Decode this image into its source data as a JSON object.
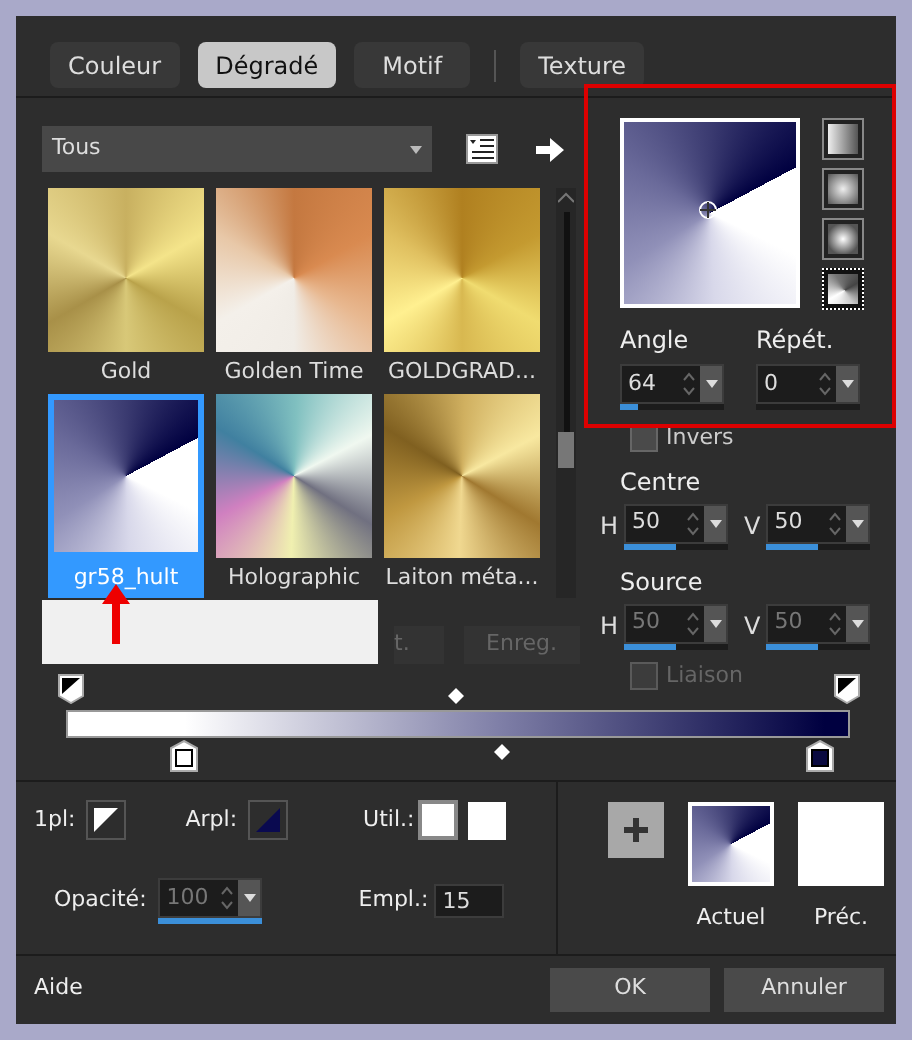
{
  "tabs": [
    {
      "label": "Couleur",
      "selected": false
    },
    {
      "label": "Dégradé",
      "selected": true
    },
    {
      "label": "Motif",
      "selected": false
    },
    {
      "label": "Texture",
      "selected": false
    }
  ],
  "category_dropdown": {
    "value": "Tous"
  },
  "gradients": [
    {
      "name": "Gold",
      "selected": false
    },
    {
      "name": "Golden Time",
      "selected": false
    },
    {
      "name": "GOLDGRAD...",
      "selected": false
    },
    {
      "name": "gr58_hult",
      "selected": true
    },
    {
      "name": "Holographic",
      "selected": false
    },
    {
      "name": "Laiton méta...",
      "selected": false
    }
  ],
  "library_buttons": [
    {
      "label": "t.",
      "disabled": true
    },
    {
      "label": "Enreg.",
      "disabled": true
    }
  ],
  "styles": [
    {
      "kind": "linear",
      "selected": false
    },
    {
      "kind": "rectangular",
      "selected": false
    },
    {
      "kind": "radial",
      "selected": false
    },
    {
      "kind": "sunburst",
      "selected": true
    }
  ],
  "angle": {
    "label": "Angle",
    "value": "64",
    "level": 0.18
  },
  "repeat": {
    "label": "Répét.",
    "value": "0"
  },
  "invert": {
    "label": "Invers",
    "checked": false
  },
  "centre": {
    "label": "Centre",
    "h": {
      "axis": "H",
      "value": "50",
      "level": 0.5
    },
    "v": {
      "axis": "V",
      "value": "50",
      "level": 0.5
    }
  },
  "source": {
    "label": "Source",
    "disabled": true,
    "h": {
      "axis": "H",
      "value": "50",
      "level": 0.5
    },
    "v": {
      "axis": "V",
      "value": "50",
      "level": 0.5
    }
  },
  "link": {
    "label": "Liaison",
    "checked": false,
    "disabled": true
  },
  "first_plan": {
    "label": "1pl:"
  },
  "back_plan": {
    "label": "Arpl:"
  },
  "user_colors": {
    "label": "Util.:"
  },
  "opacity": {
    "label": "Opacité:",
    "value": "100",
    "level": 1,
    "disabled": true
  },
  "location": {
    "label": "Empl.:",
    "value": "15"
  },
  "previews": [
    {
      "label": "Actuel",
      "kind": "gradient"
    },
    {
      "label": "Préc.",
      "kind": "white"
    }
  ],
  "footer": {
    "help": "Aide",
    "buttons": [
      "OK",
      "Annuler"
    ]
  }
}
